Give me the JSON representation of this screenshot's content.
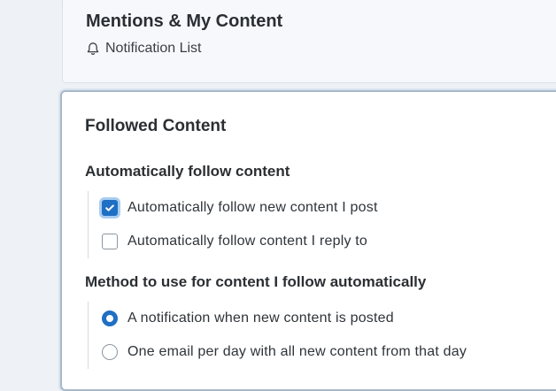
{
  "mentions": {
    "title": "Mentions & My Content",
    "notification_link": "Notification List",
    "notification_icon": "bell-icon"
  },
  "followed": {
    "title": "Followed Content",
    "auto_follow": {
      "heading": "Automatically follow content",
      "options": [
        {
          "label": "Automatically follow new content I post",
          "checked": true
        },
        {
          "label": "Automatically follow content I reply to",
          "checked": false
        }
      ]
    },
    "method": {
      "heading": "Method to use for content I follow automatically",
      "options": [
        {
          "label": "A notification when new content is posted",
          "selected": true
        },
        {
          "label": "One email per day with all new content from that day",
          "selected": false
        }
      ]
    }
  },
  "colors": {
    "accent": "#1f6fc4",
    "panel_border": "#a9b8c8",
    "background": "#eef1f5"
  }
}
